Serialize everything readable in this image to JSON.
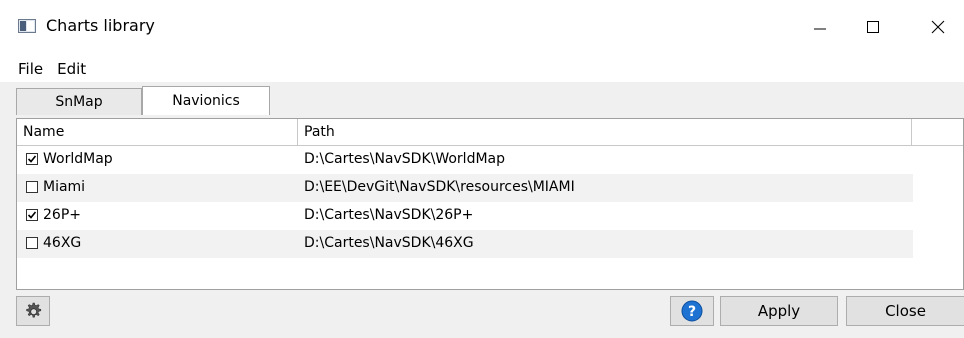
{
  "window": {
    "title": "Charts library",
    "app_icon": "app-window-icon",
    "controls": {
      "minimize_icon": "minimize-icon",
      "maximize_icon": "maximize-icon",
      "close_icon": "close-icon"
    }
  },
  "menu": {
    "items": [
      {
        "label": "File"
      },
      {
        "label": "Edit"
      }
    ]
  },
  "tabs": [
    {
      "label": "SnMap",
      "active": false
    },
    {
      "label": "Navionics",
      "active": true
    }
  ],
  "table": {
    "columns": [
      "Name",
      "Path",
      ""
    ],
    "rows": [
      {
        "checked": true,
        "name": "WorldMap",
        "path": "D:\\Cartes\\NavSDK\\WorldMap"
      },
      {
        "checked": false,
        "name": "Miami",
        "path": "D:\\EE\\DevGit\\NavSDK\\resources\\MIAMI"
      },
      {
        "checked": true,
        "name": "26P+",
        "path": "D:\\Cartes\\NavSDK\\26P+"
      },
      {
        "checked": false,
        "name": "46XG",
        "path": "D:\\Cartes\\NavSDK\\46XG"
      }
    ]
  },
  "footer": {
    "settings_icon": "gear-icon",
    "help_icon": "help-icon",
    "apply_label": "Apply",
    "close_label": "Close"
  },
  "colors": {
    "panel_bg": "#f0f0f0",
    "button_bg": "#e1e1e1",
    "help_blue": "#1e72d2",
    "alt_row": "#f2f2f2"
  }
}
